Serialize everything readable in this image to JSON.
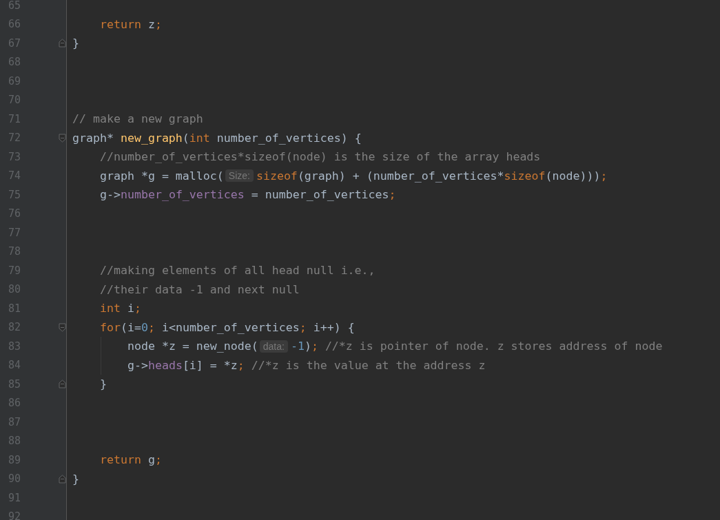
{
  "editor": {
    "lines": [
      {
        "number": "65"
      },
      {
        "number": "66",
        "tokens": [
          {
            "text": "    return",
            "kind": "keyword"
          },
          {
            "text": " z",
            "kind": "plain"
          },
          {
            "text": ";",
            "kind": "keyword"
          }
        ]
      },
      {
        "number": "67",
        "fold_end": true,
        "tokens": [
          {
            "text": "}",
            "kind": "plain"
          }
        ]
      },
      {
        "number": "68"
      },
      {
        "number": "69"
      },
      {
        "number": "70"
      },
      {
        "number": "71",
        "tokens": [
          {
            "text": "// make a new graph",
            "kind": "comment"
          }
        ]
      },
      {
        "number": "72",
        "fold_start": true,
        "tokens": [
          {
            "text": "graph* ",
            "kind": "plain"
          },
          {
            "text": "new_graph",
            "kind": "function"
          },
          {
            "text": "(",
            "kind": "plain"
          },
          {
            "text": "int",
            "kind": "keyword"
          },
          {
            "text": " number_of_vertices) {",
            "kind": "plain"
          }
        ]
      },
      {
        "number": "73",
        "tokens": [
          {
            "text": "    //number_of_vertices*sizeof(node) is the size of the array heads",
            "kind": "comment"
          }
        ]
      },
      {
        "number": "74",
        "tokens": [
          {
            "text": "    graph *g = malloc(",
            "kind": "plain"
          },
          {
            "text": "Size:",
            "kind": "hint"
          },
          {
            "text": "sizeof",
            "kind": "keyword"
          },
          {
            "text": "(graph) + (number_of_vertices*",
            "kind": "plain"
          },
          {
            "text": "sizeof",
            "kind": "keyword"
          },
          {
            "text": "(node)))",
            "kind": "plain"
          },
          {
            "text": ";",
            "kind": "keyword"
          }
        ]
      },
      {
        "number": "75",
        "tokens": [
          {
            "text": "    g->",
            "kind": "plain"
          },
          {
            "text": "number_of_vertices",
            "kind": "member"
          },
          {
            "text": " = number_of_vertices",
            "kind": "plain"
          },
          {
            "text": ";",
            "kind": "keyword"
          }
        ]
      },
      {
        "number": "76"
      },
      {
        "number": "77"
      },
      {
        "number": "78"
      },
      {
        "number": "79",
        "tokens": [
          {
            "text": "    //making elements of all head null i.e.,",
            "kind": "comment"
          }
        ]
      },
      {
        "number": "80",
        "tokens": [
          {
            "text": "    //their data -1 and next null",
            "kind": "comment"
          }
        ]
      },
      {
        "number": "81",
        "tokens": [
          {
            "text": "    int",
            "kind": "keyword"
          },
          {
            "text": " i",
            "kind": "plain"
          },
          {
            "text": ";",
            "kind": "keyword"
          }
        ]
      },
      {
        "number": "82",
        "fold_start": true,
        "tokens": [
          {
            "text": "    for",
            "kind": "keyword"
          },
          {
            "text": "(i=",
            "kind": "plain"
          },
          {
            "text": "0",
            "kind": "number"
          },
          {
            "text": ";",
            "kind": "keyword"
          },
          {
            "text": " i<number_of_vertices",
            "kind": "plain"
          },
          {
            "text": ";",
            "kind": "keyword"
          },
          {
            "text": " i++) {",
            "kind": "plain"
          }
        ]
      },
      {
        "number": "83",
        "indent_guide": true,
        "tokens": [
          {
            "text": "        node *z = new_node(",
            "kind": "plain"
          },
          {
            "text": "data:",
            "kind": "hint"
          },
          {
            "text": "-1",
            "kind": "number"
          },
          {
            "text": ")",
            "kind": "plain"
          },
          {
            "text": ";",
            "kind": "keyword"
          },
          {
            "text": " //*z is pointer of node. z stores address of node",
            "kind": "comment"
          }
        ]
      },
      {
        "number": "84",
        "indent_guide": true,
        "tokens": [
          {
            "text": "        g->",
            "kind": "plain"
          },
          {
            "text": "heads",
            "kind": "member"
          },
          {
            "text": "[i] = *z",
            "kind": "plain"
          },
          {
            "text": ";",
            "kind": "keyword"
          },
          {
            "text": " //*z is the value at the address z",
            "kind": "comment"
          }
        ]
      },
      {
        "number": "85",
        "fold_end": true,
        "tokens": [
          {
            "text": "    }",
            "kind": "plain"
          }
        ]
      },
      {
        "number": "86"
      },
      {
        "number": "87"
      },
      {
        "number": "88"
      },
      {
        "number": "89",
        "tokens": [
          {
            "text": "    return",
            "kind": "keyword"
          },
          {
            "text": " g",
            "kind": "plain"
          },
          {
            "text": ";",
            "kind": "keyword"
          }
        ]
      },
      {
        "number": "90",
        "fold_end": true,
        "tokens": [
          {
            "text": "}",
            "kind": "plain"
          }
        ]
      },
      {
        "number": "91"
      },
      {
        "number": "92"
      }
    ]
  }
}
